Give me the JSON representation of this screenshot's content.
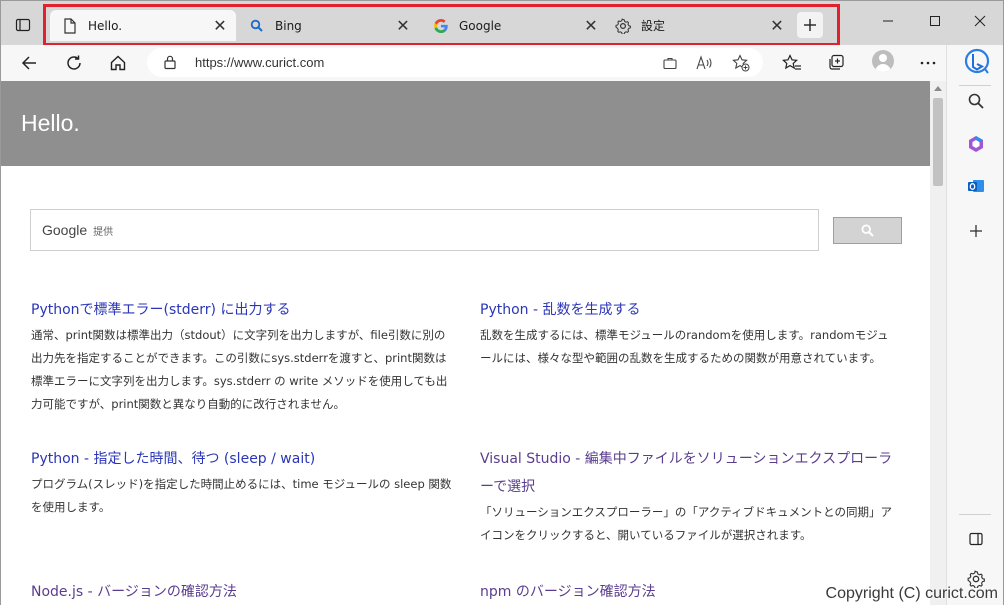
{
  "tabs": [
    {
      "label": "Hello.",
      "icon": "page-icon",
      "active": true
    },
    {
      "label": "Bing",
      "icon": "bing-search-icon",
      "active": false
    },
    {
      "label": "Google",
      "icon": "google-icon",
      "active": false
    },
    {
      "label": "設定",
      "icon": "gear-icon",
      "active": false
    }
  ],
  "window_controls": {
    "minimize": "–",
    "maximize": "□",
    "close": "✕"
  },
  "address": {
    "url": "https://www.curict.com"
  },
  "page": {
    "site_title": "Hello.",
    "search": {
      "brand": "Google",
      "brand_sub": "提供"
    },
    "articles": [
      {
        "title": "Pythonで標準エラー(stderr) に出力する",
        "excerpt": "通常、print関数は標準出力（stdout）に文字列を出力しますが、file引数に別の出力先を指定することができます。この引数にsys.stderrを渡すと、print関数は標準エラーに文字列を出力します。sys.stderr の write メソッドを使用しても出力可能ですが、print関数と異なり自動的に改行されません。"
      },
      {
        "title": "Python - 乱数を生成する",
        "excerpt": "乱数を生成するには、標準モジュールのrandomを使用します。randomモジュールには、様々な型や範囲の乱数を生成するための関数が用意されています。"
      },
      {
        "title": "Python - 指定した時間、待つ (sleep / wait)",
        "excerpt": "プログラム(スレッド)を指定した時間止めるには、time モジュールの sleep 関数を使用します。"
      },
      {
        "title": "Visual Studio - 編集中ファイルをソリューションエクスプローラーで選択",
        "excerpt": "「ソリューションエクスプローラー」の「アクティブドキュメントとの同期」アイコンをクリックすると、開いているファイルが選択されます。"
      },
      {
        "title": "Node.js - バージョンの確認方法",
        "excerpt": ""
      },
      {
        "title": "npm のバージョン確認方法",
        "excerpt": ""
      }
    ]
  },
  "watermark": "Copyright (C) curict.com",
  "colors": {
    "highlight": "#e0222f",
    "link": "#2a36b7",
    "visited": "#5a3d8e",
    "header_bg": "#8f8f8f"
  }
}
